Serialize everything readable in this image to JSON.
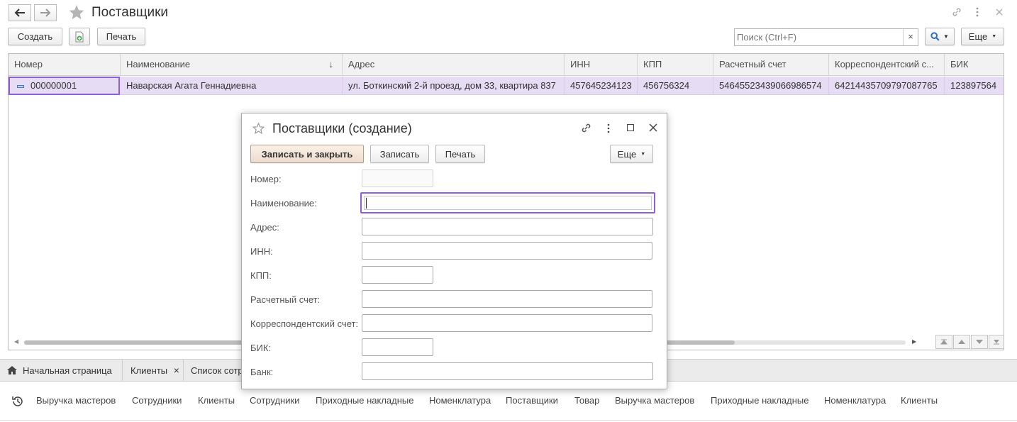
{
  "window": {
    "title": "Поставщики"
  },
  "toolbar": {
    "create_label": "Создать",
    "print_label": "Печать",
    "more_label": "Еще",
    "search_placeholder": "Поиск (Ctrl+F)",
    "search_clear": "×"
  },
  "table": {
    "columns": [
      "Номер",
      "Наименование",
      "Адрес",
      "ИНН",
      "КПП",
      "Расчетный счет",
      "Корреспондентский с...",
      "БИК"
    ],
    "sort_indicator": "↓",
    "rows": [
      {
        "number": "000000001",
        "name": "Наварская Агата Геннадиевна",
        "address": "ул. Боткинский 2-й проезд, дом 33, квартира 837",
        "inn": "457645234123",
        "kpp": "456756324",
        "account": "54645523439066986574",
        "corr_account": "64214435709797087765",
        "bik": "123897564"
      }
    ]
  },
  "tabs": [
    {
      "label": "Начальная страница"
    },
    {
      "label": "Клиенты",
      "close": "×"
    },
    {
      "label": "Список сотр"
    }
  ],
  "history": [
    "Выручка мастеров",
    "Сотрудники",
    "Клиенты",
    "Сотрудники",
    "Приходные накладные",
    "Номенклатура",
    "Поставщики",
    "Товар",
    "Выручка мастеров",
    "Приходные накладные",
    "Номенклатура",
    "Клиенты"
  ],
  "dialog": {
    "title": "Поставщики (создание)",
    "save_close_label": "Записать и закрыть",
    "save_label": "Записать",
    "print_label": "Печать",
    "more_label": "Еще",
    "fields": {
      "number": {
        "label": "Номер:",
        "value": ""
      },
      "name": {
        "label": "Наименование:",
        "value": ""
      },
      "address": {
        "label": "Адрес:",
        "value": ""
      },
      "inn": {
        "label": "ИНН:",
        "value": ""
      },
      "kpp": {
        "label": "КПП:",
        "value": ""
      },
      "account": {
        "label": "Расчетный счет:",
        "value": ""
      },
      "corr_account": {
        "label": "Корреспондентский счет:",
        "value": ""
      },
      "bik": {
        "label": "БИК:",
        "value": ""
      },
      "bank": {
        "label": "Банк:",
        "value": ""
      }
    }
  },
  "colors": {
    "selection_row": "#e6dcf3",
    "focus_border": "#8f5fd9",
    "search_accent": "#2f6fbf"
  }
}
